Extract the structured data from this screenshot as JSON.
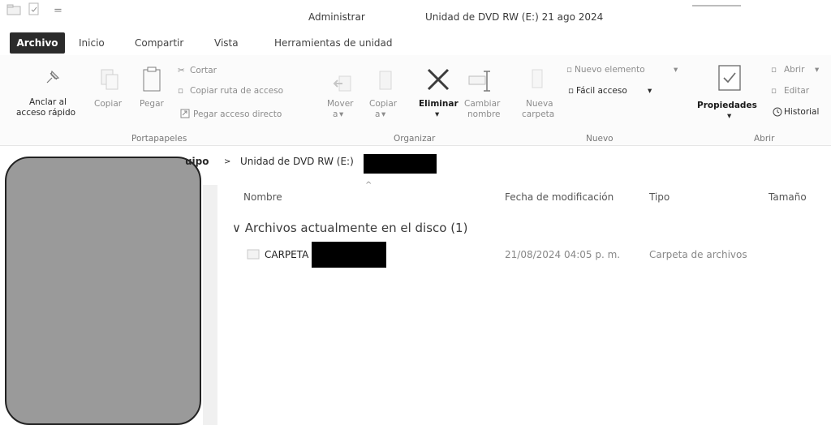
{
  "window": {
    "contextual_tab_title": "Administrar",
    "title": "Unidad de DVD RW (E:) 21 ago 2024",
    "quick_access_dropdown": "="
  },
  "tabs": [
    "Archivo",
    "Inicio",
    "Compartir",
    "Vista",
    "Herramientas de unidad"
  ],
  "ribbon": {
    "portapapeles": {
      "pin_label_1": "Anclar al",
      "pin_label_2": "acceso rápido",
      "copy": "Copiar",
      "paste": "Pegar",
      "cut": "Cortar",
      "copy_path": "Copiar ruta de acceso",
      "paste_shortcut": "Pegar acceso directo",
      "group_label": "Portapapeles"
    },
    "organizar": {
      "move_1": "Mover",
      "move_2": "a",
      "copy_1": "Copiar",
      "copy_2": "a",
      "delete": "Eliminar",
      "rename_1": "Cambiar",
      "rename_2": "nombre",
      "group_label": "Organizar"
    },
    "nuevo": {
      "new_folder_1": "Nueva",
      "new_folder_2": "carpeta",
      "new_item": "Nuevo elemento",
      "easy_access": "Fácil acceso",
      "group_label": "Nuevo"
    },
    "abrir": {
      "properties": "Propiedades",
      "open": "Abrir",
      "edit": "Editar",
      "history": "Historial",
      "group_label": "Abrir"
    }
  },
  "breadcrumb": {
    "partial": "uipo",
    "separator": ">",
    "drive": "Unidad de DVD RW (E:)"
  },
  "columns": {
    "name": "Nombre",
    "date": "Fecha de modificación",
    "type": "Tipo",
    "size": "Tamaño"
  },
  "group": {
    "chevron": "∨",
    "title": "Archivos actualmente en el disco (1)"
  },
  "rows": [
    {
      "name": "CARPETA",
      "date": "21/08/2024 04:05 p. m.",
      "type": "Carpeta de archivos"
    }
  ],
  "colors": {
    "file_tab_bg": "#2b2b2b",
    "redaction": "#000000",
    "nav_blur": "#9a9a9a"
  }
}
